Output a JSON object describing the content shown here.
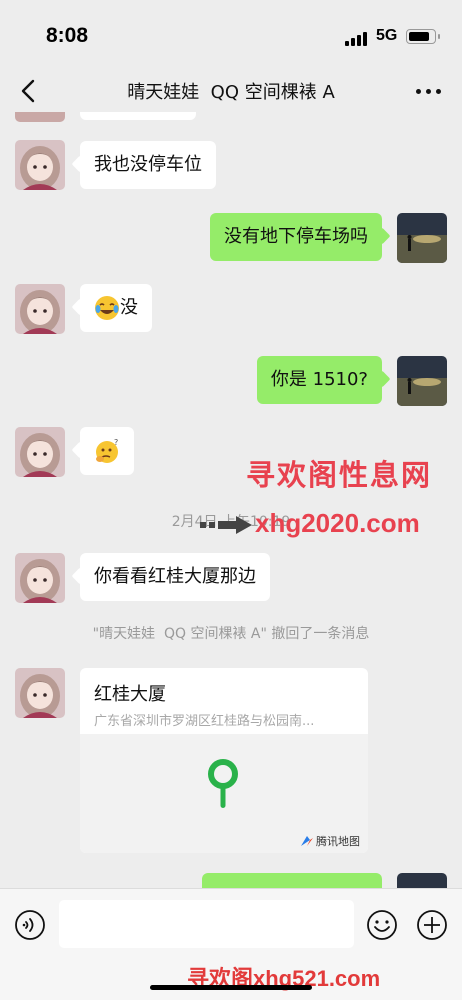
{
  "status_bar": {
    "time": "8:08",
    "network": "5G",
    "battery_level": 0.85
  },
  "nav": {
    "title": "晴天娃娃  QQ 空间棵裱 A",
    "back_icon": "chevron-left-icon",
    "more_icon": "more-dots-icon"
  },
  "messages": [
    {
      "side": "left",
      "text": "我也没停车位"
    },
    {
      "side": "right",
      "text": "没有地下停车场吗"
    },
    {
      "side": "left",
      "text": "没",
      "emoji": "crying-laughing-face"
    },
    {
      "side": "right",
      "text": "你是 1510?"
    },
    {
      "side": "left",
      "text": "",
      "emoji": "thinking-face"
    },
    {
      "side": "left",
      "text": "你看看红桂大厦那边"
    }
  ],
  "timestamp": "2月4日 上午10:19",
  "system_message": "\"晴天娃娃  QQ 空间棵裱 A\" 撤回了一条消息",
  "location": {
    "name": "红桂大厦",
    "address": "广东省深圳市罗湖区红桂路与松园南...",
    "map_credit": "腾讯地图",
    "pin_color": "#2ab24a"
  },
  "watermarks": {
    "top": "寻欢阁性息网",
    "middle": "xhg2020.com",
    "bottom": "寻欢阁xhg521.com"
  },
  "input_bar": {
    "placeholder": "",
    "voice_icon": "voice-icon",
    "emoji_icon": "emoji-icon",
    "plus_icon": "plus-icon"
  },
  "colors": {
    "background": "#ededed",
    "sent_bubble": "#95ec69",
    "received_bubble": "#ffffff",
    "watermark": "#e8424f"
  }
}
